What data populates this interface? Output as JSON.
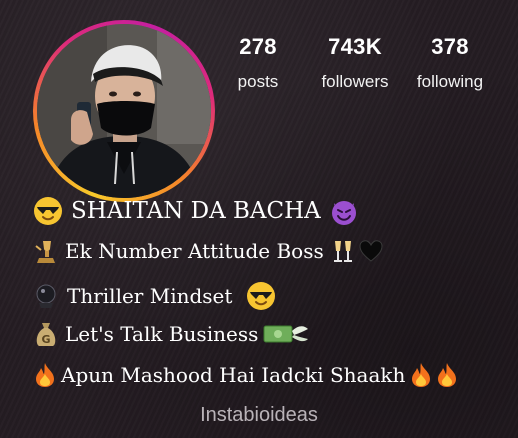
{
  "profile": {
    "stats": [
      {
        "count": "278",
        "label": "posts"
      },
      {
        "count": "743K",
        "label": "followers"
      },
      {
        "count": "378",
        "label": "following"
      }
    ],
    "avatar_icon": "profile-photo"
  },
  "bio": {
    "lines": [
      {
        "text": "SHAITAN DA BACHA",
        "lead_icon": "sunglasses-emoji",
        "trail_icons": [
          "smiling-devil-emoji"
        ]
      },
      {
        "text": "Ek Number Attitude Boss",
        "lead_icon": "trophy-emoji",
        "trail_icons": [
          "champagne-toast-emoji",
          "black-heart-emoji"
        ]
      },
      {
        "text": "Thriller Mindset",
        "lead_icon": "crystal-ball-emoji",
        "trail_icons": [
          "sunglasses-emoji"
        ]
      },
      {
        "text": "Let's Talk Business",
        "lead_icon": "money-bag-emoji",
        "trail_icons": [
          "money-with-wings-emoji"
        ]
      },
      {
        "text": "Apun Mashood Hai Iadcki Shaakh",
        "lead_icon": "fire-emoji",
        "trail_icons": [
          "fire-emoji",
          "fire-emoji"
        ]
      }
    ]
  },
  "watermark": "Instabioideas",
  "colors": {
    "background": "#241c22",
    "story_ring": [
      "#f8c92a",
      "#f58529",
      "#dd2a7b",
      "#c41fa0"
    ],
    "text": "#ffffff",
    "watermark": "#b9b3b8"
  }
}
